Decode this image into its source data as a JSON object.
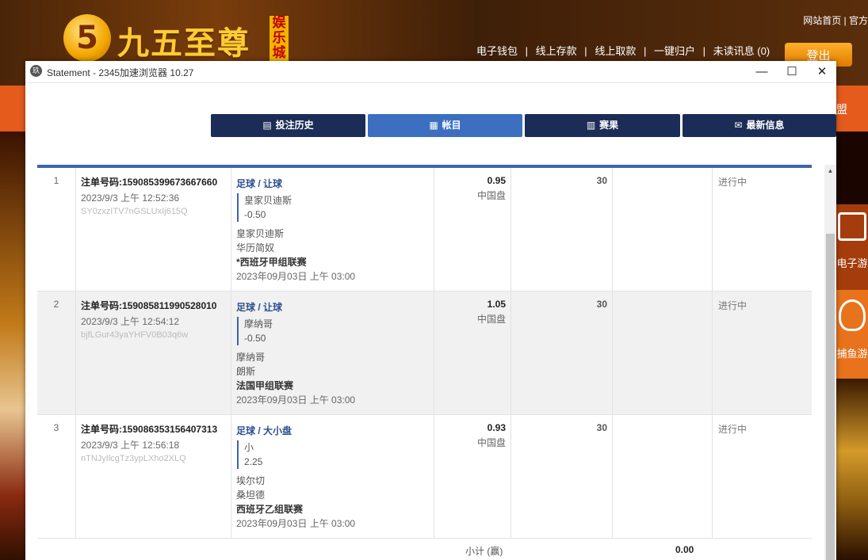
{
  "site": {
    "logo_digit": "5",
    "logo_text": "九五至尊",
    "logo_badge": "娱乐城",
    "top_links": "网站首页 | 官方",
    "wallet_nav": [
      "电子钱包",
      "|",
      "线上存款",
      "|",
      "线上取款",
      "|",
      "一键归户",
      "|",
      "未读讯息 (0)"
    ],
    "logout_label": "登出",
    "nav_right_label": "盟",
    "tile_elec_label": "电子游",
    "tile_fish_label": "捕鱼游"
  },
  "browser": {
    "title": "Statement - 2345加速浏览器 10.27",
    "icon_text": "玖",
    "min_label": "—",
    "max_label": "☐",
    "close_label": "✕"
  },
  "tabs": [
    {
      "label": "投注历史",
      "icon": "▤"
    },
    {
      "label": "帐目",
      "icon": "▦"
    },
    {
      "label": "赛果",
      "icon": "▥"
    },
    {
      "label": "最新信息",
      "icon": "✉"
    }
  ],
  "rows": [
    {
      "index": "1",
      "ticket": "注单号码:159085399673667660",
      "datetime": "2023/9/3 上午 12:52:36",
      "hash": "SY0zxzITV7nGSLUxIj615Q",
      "market": "足球 / 让球",
      "selection": "皇家贝迪斯",
      "handicap": "-0.50",
      "home": "皇家贝迪斯",
      "away": "华历简奴",
      "league": "*西班牙甲组联赛",
      "match_time": "2023年09月03日 上午 03:00",
      "odds": "0.95",
      "odds_type": "中国盘",
      "stake": "30",
      "status": "进行中"
    },
    {
      "index": "2",
      "ticket": "注单号码:159085811990528010",
      "datetime": "2023/9/3 上午 12:54:12",
      "hash": "bjfLGur43yaYHFV0B03q6w",
      "market": "足球 / 让球",
      "selection": "摩纳哥",
      "handicap": "-0.50",
      "home": "摩纳哥",
      "away": "朗斯",
      "league": "法国甲组联赛",
      "match_time": "2023年09月03日 上午 03:00",
      "odds": "1.05",
      "odds_type": "中国盘",
      "stake": "30",
      "status": "进行中"
    },
    {
      "index": "3",
      "ticket": "注单号码:159086353156407313",
      "datetime": "2023/9/3 上午 12:56:18",
      "hash": "nTNJyIlcgTz3ypLXho2XLQ",
      "market": "足球 / 大小盘",
      "selection": "小",
      "handicap": "2.25",
      "home": "埃尔切",
      "away": "桑坦德",
      "league": "西班牙乙组联赛",
      "match_time": "2023年09月03日 上午 03:00",
      "odds": "0.93",
      "odds_type": "中国盘",
      "stake": "30",
      "status": "进行中"
    }
  ],
  "subtotal": {
    "label": "小计 (赢)",
    "value": "0.00"
  },
  "colors": {
    "tab_dark": "#1b2c57",
    "tab_active": "#3c6fc0",
    "accent": "#3d64ad"
  }
}
